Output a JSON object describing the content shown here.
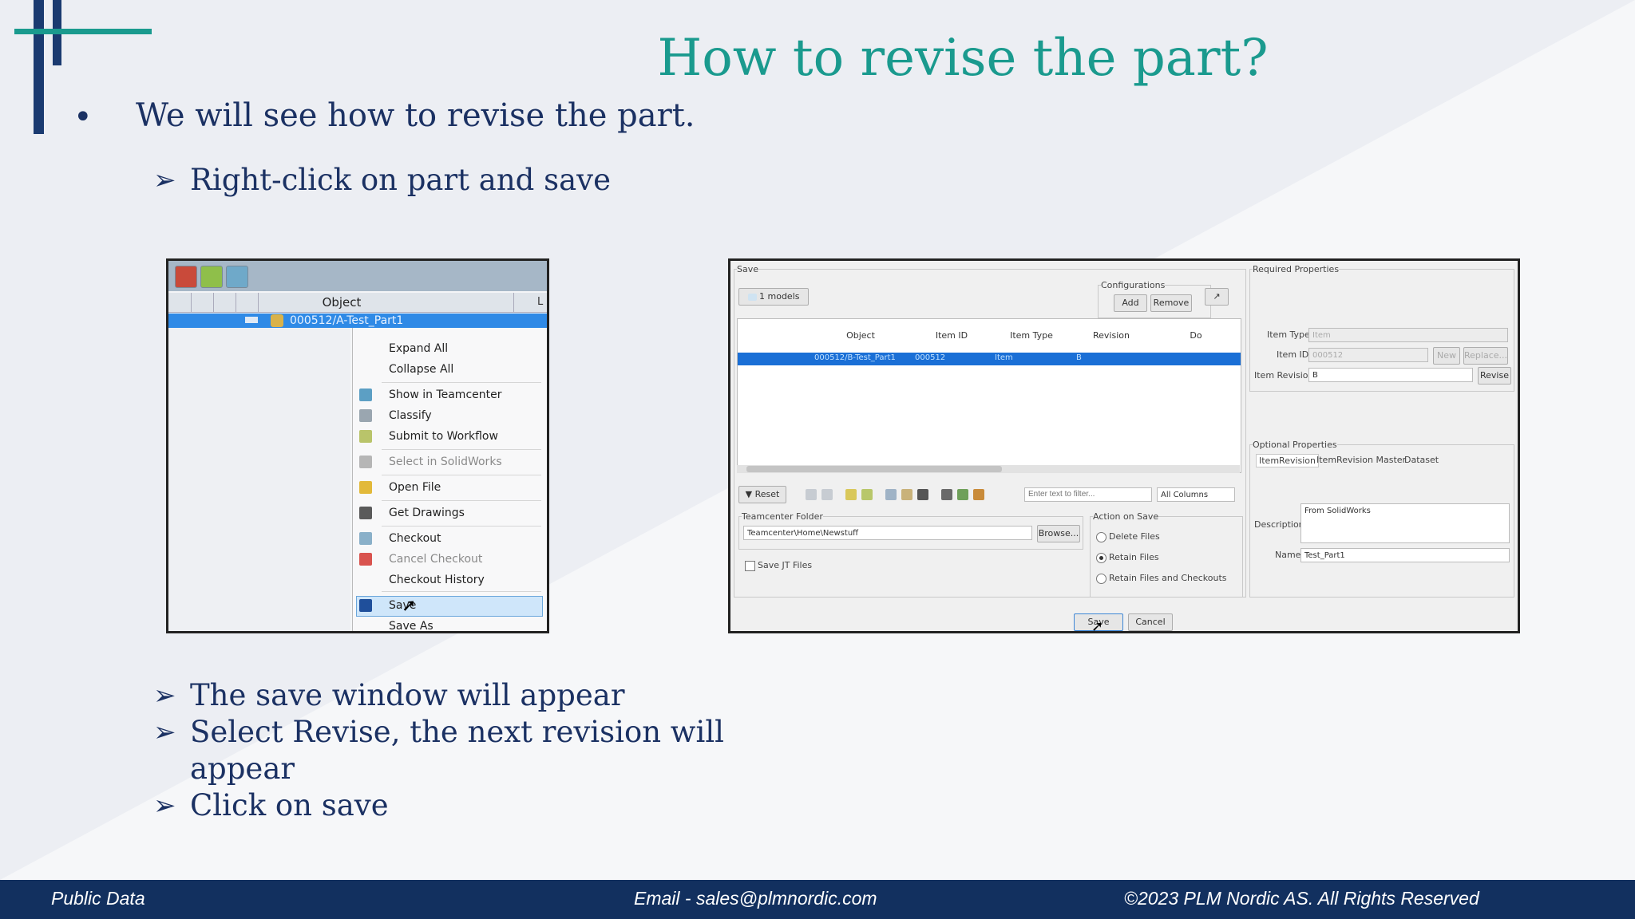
{
  "slide": {
    "title": "How to revise the part?",
    "bullet_symbol": "•",
    "bullet": "We will see how to revise the part.",
    "sub_top": "Right-click on part and save",
    "sub_bottom": [
      "The save window will appear",
      "Select Revise, the next revision will",
      "appear",
      "Click on save"
    ],
    "arrow_symbol": "➢"
  },
  "context_menu_shot": {
    "column_header": "Object",
    "column_header_2": "L",
    "selected_item": "000512/A-Test_Part1",
    "items": [
      "Expand All",
      "Collapse All",
      "Show in Teamcenter",
      "Classify",
      "Submit to Workflow",
      "Select in SolidWorks",
      "Open File",
      "Get Drawings",
      "Checkout",
      "Cancel Checkout",
      "Checkout History",
      "Save",
      "Save As"
    ]
  },
  "save_dialog_shot": {
    "group_save": "Save",
    "models_count": "1 models",
    "configurations_label": "Configurations",
    "add_btn": "Add",
    "remove_btn": "Remove",
    "columns": [
      "Object",
      "Item ID",
      "Item Type",
      "Revision",
      "Do"
    ],
    "row": {
      "object": "000512/B-Test_Part1",
      "item_id": "000512",
      "item_type": "Item",
      "revision": "B"
    },
    "reset_btn": "Reset",
    "filter_placeholder": "Enter text to filter...",
    "columns_select": "All Columns",
    "tc_folder_label": "Teamcenter Folder",
    "tc_folder_value": "Teamcenter\\Home\\Newstuff",
    "browse_btn": "Browse...",
    "save_jt": "Save JT Files",
    "action_label": "Action on Save",
    "actions": [
      "Delete Files",
      "Retain Files",
      "Retain Files and Checkouts"
    ],
    "required_label": "Required Properties",
    "item_type_label": "Item Type",
    "item_type_value": "Item",
    "item_id_label": "Item ID",
    "item_id_value": "000512",
    "new_btn": "New",
    "replace_btn": "Replace...",
    "item_rev_label": "Item Revision",
    "item_rev_value": "B",
    "revise_btn": "Revise",
    "optional_label": "Optional Properties",
    "tabs": [
      "ItemRevision",
      "ItemRevision Master",
      "Dataset"
    ],
    "description_label": "Description",
    "description_value": "From SolidWorks",
    "name_label": "Name",
    "name_value": "Test_Part1",
    "save_btn": "Save",
    "cancel_btn": "Cancel"
  },
  "footer": {
    "left": "Public Data",
    "center": "Email - sales@plmnordic.com",
    "right": "©2023 PLM Nordic AS. All Rights Reserved"
  },
  "colors": {
    "title": "#1a9a8e",
    "text": "#1b3163",
    "footer_bg": "#12305f",
    "accent_bar": "#1a3a70"
  }
}
